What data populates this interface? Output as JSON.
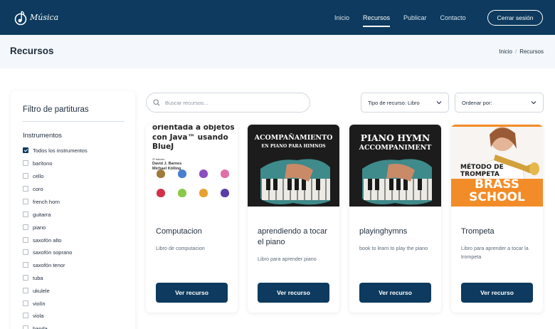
{
  "brand": {
    "name": "Música"
  },
  "nav": {
    "links": [
      "Inicio",
      "Recursos",
      "Publicar",
      "Contacto"
    ],
    "active": "Recursos",
    "logout_label": "Cerrar sesión"
  },
  "page": {
    "title": "Recursos",
    "breadcrumb": [
      "Inicio",
      "Recursos"
    ]
  },
  "sidebar": {
    "title": "Filtro de partituras",
    "section": "Instrumentos",
    "options": [
      {
        "label": "Todos los instrumentos",
        "checked": true
      },
      {
        "label": "barítono",
        "checked": false
      },
      {
        "label": "cello",
        "checked": false
      },
      {
        "label": "coro",
        "checked": false
      },
      {
        "label": "french horn",
        "checked": false
      },
      {
        "label": "guitarra",
        "checked": false
      },
      {
        "label": "piano",
        "checked": false
      },
      {
        "label": "saxofón alto",
        "checked": false
      },
      {
        "label": "saxofón soprano",
        "checked": false
      },
      {
        "label": "saxofón tenor",
        "checked": false
      },
      {
        "label": "tuba",
        "checked": false
      },
      {
        "label": "ukulele",
        "checked": false
      },
      {
        "label": "violín",
        "checked": false
      },
      {
        "label": "viola",
        "checked": false
      },
      {
        "label": "banda",
        "checked": false
      }
    ]
  },
  "controls": {
    "search_placeholder": "Buscar recursos...",
    "type_select": "Tipo de recurso: Libro",
    "order_select": "Ordenar por:"
  },
  "cards": [
    {
      "title": "Computacion",
      "description": "Libro de computacion",
      "button": "Ver recurso",
      "cover": {
        "lines": [
          "orientada a objetos",
          "con Java™ usando",
          "BlueJ"
        ],
        "edition": "2ª edición",
        "authors": [
          "David J. Barnes",
          "Michael Kölling"
        ]
      }
    },
    {
      "title": "aprendiendo a tocar el piano",
      "description": "Libro para aprender piano",
      "button": "Ver recurso",
      "cover": {
        "lines": [
          "ACOMPAÑAMIENTO",
          "EN PIANO PARA HIMNOS"
        ]
      }
    },
    {
      "title": "playinghymns",
      "description": "book to learn to play the piano",
      "button": "Ver recurso",
      "cover": {
        "lines": [
          "PIANO HYMN",
          "ACCOMPANIMENT"
        ]
      }
    },
    {
      "title": "Trompeta",
      "description": "Libro para aprender a tocar la trompeta",
      "button": "Ver recurso",
      "cover": {
        "lines": [
          "MÉTODO DE",
          "TROMPETA"
        ],
        "brand_lines": [
          "BRASS",
          "SCHOOL"
        ]
      }
    }
  ],
  "colors": {
    "primary": "#0d3a5e",
    "header_bg": "#f4f8fc",
    "accent_orange": "#f28c28"
  }
}
